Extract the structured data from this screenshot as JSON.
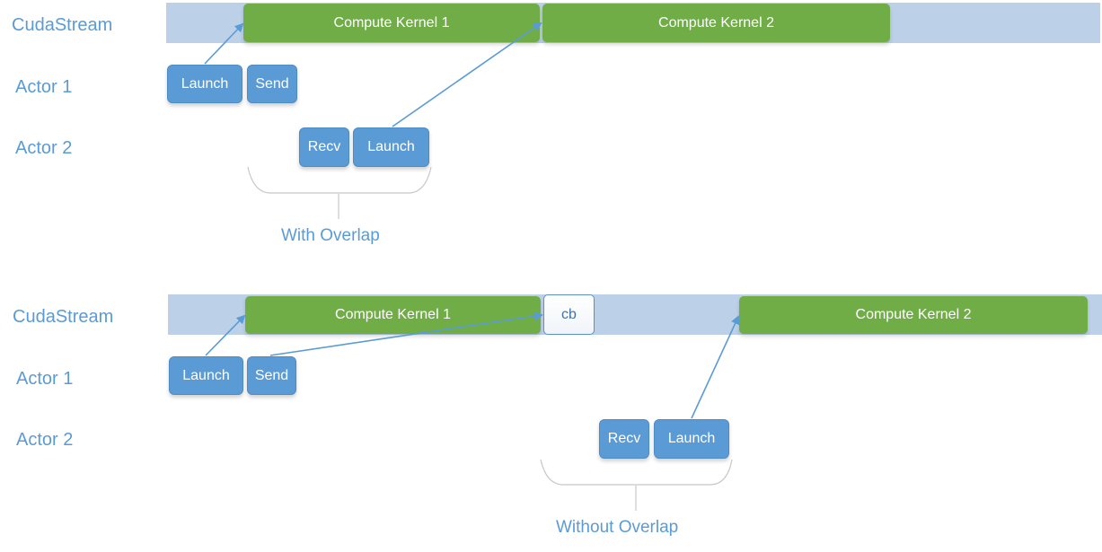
{
  "colors": {
    "label": "#5b9bd5",
    "lane": "#bcd0e8",
    "kernel": "#70ad47",
    "op": "#5b9bd5",
    "arrow": "#5b9bd5",
    "brace": "#c8c8c8"
  },
  "panels": [
    {
      "rows": [
        "CudaStream",
        "Actor 1",
        "Actor 2"
      ],
      "stream": {
        "kernels": [
          "Compute Kernel 1",
          "Compute Kernel 2"
        ]
      },
      "actor1": [
        "Launch",
        "Send"
      ],
      "actor2": [
        "Recv",
        "Launch"
      ],
      "caption": "With Overlap"
    },
    {
      "rows": [
        "CudaStream",
        "Actor 1",
        "Actor 2"
      ],
      "stream": {
        "kernels": [
          "Compute Kernel 1",
          "Compute Kernel 2"
        ],
        "callback": "cb"
      },
      "actor1": [
        "Launch",
        "Send"
      ],
      "actor2": [
        "Recv",
        "Launch"
      ],
      "caption": "Without Overlap"
    }
  ]
}
